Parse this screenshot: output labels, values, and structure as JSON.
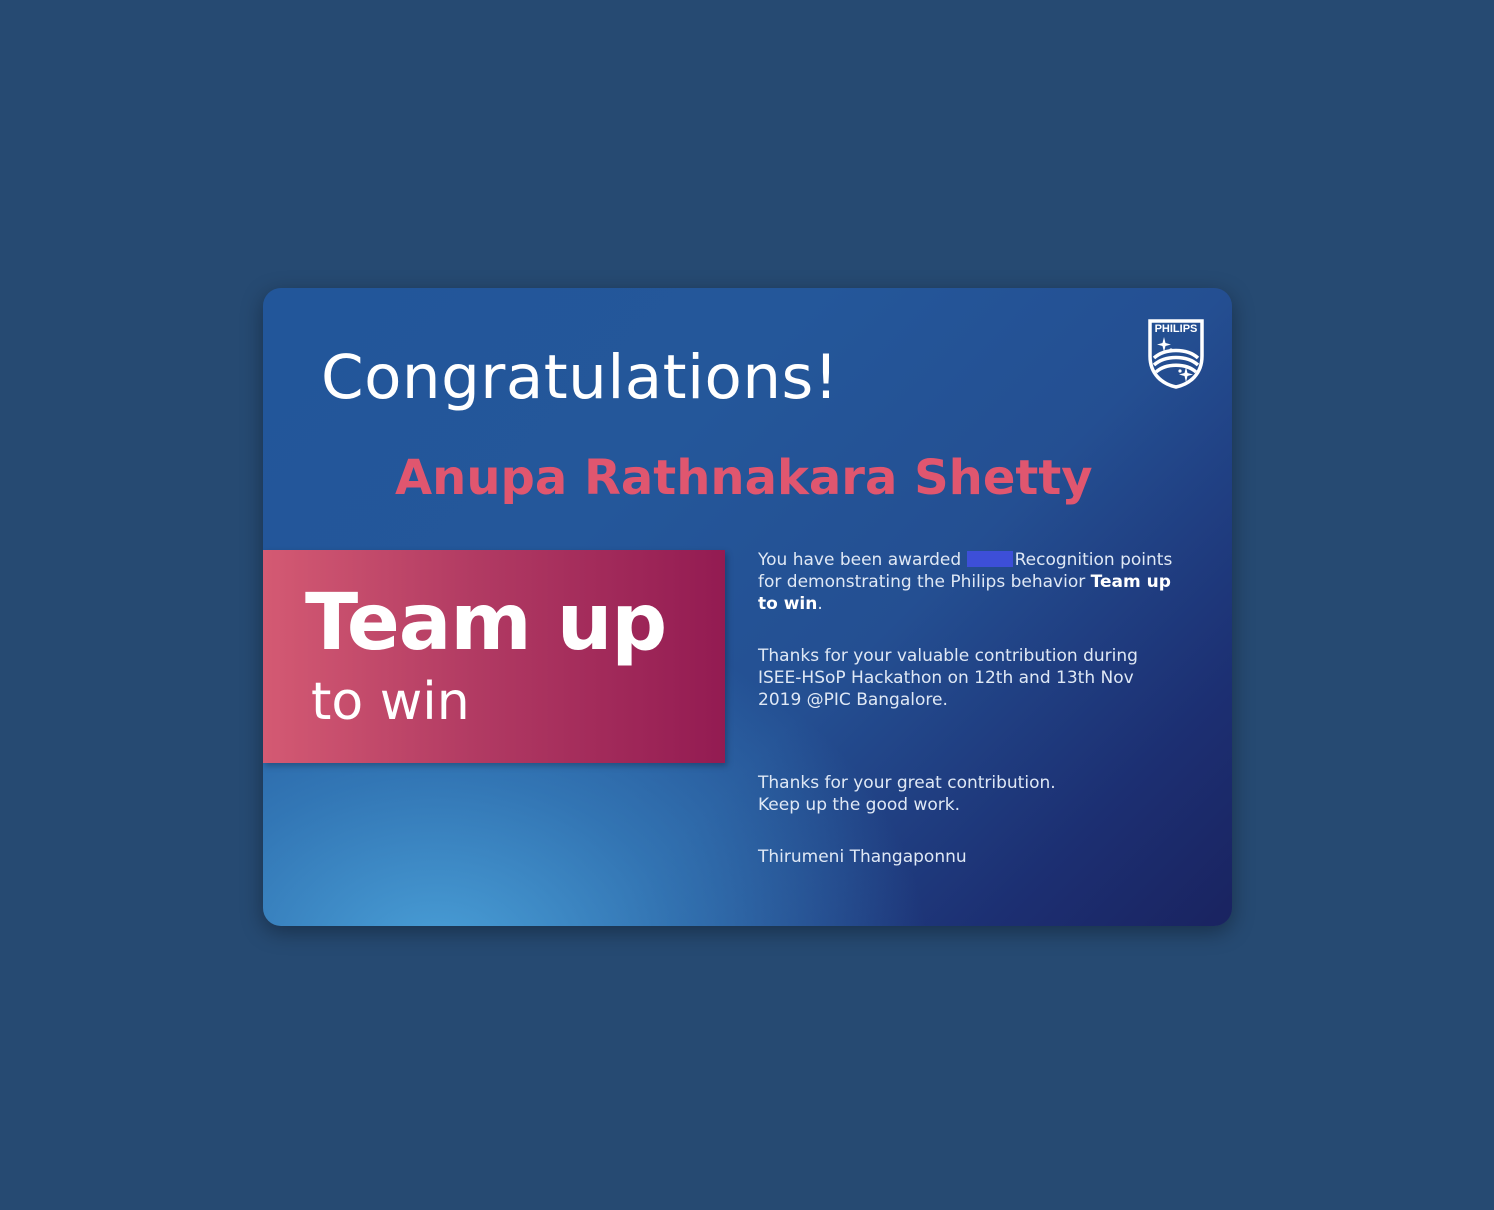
{
  "card": {
    "heading": "Congratulations!",
    "recipient": "Anupa Rathnakara Shetty",
    "banner": {
      "line1": "Team up",
      "line2": "to win"
    },
    "message": {
      "award_prefix": "You have been awarded",
      "award_suffix": "Recognition points for demonstrating the Philips behavior",
      "behavior": "Team up to win",
      "behavior_end": ".",
      "contribution": "Thanks for your valuable contribution during ISEE-HSoP Hackathon on 12th and 13th Nov 2019 @PIC Bangalore.",
      "closing_line1": "Thanks for your great contribution.",
      "closing_line2": "Keep up the good work.",
      "signer": "Thirumeni Thangaponnu"
    },
    "logo": {
      "icon": "philips-shield-icon",
      "text": "PHILIPS"
    }
  },
  "colors": {
    "page_background": "#264a72",
    "recipient": "#e0566f",
    "banner_start": "#d45a73",
    "banner_end": "#931b52",
    "redaction": "#3d4fd8"
  }
}
